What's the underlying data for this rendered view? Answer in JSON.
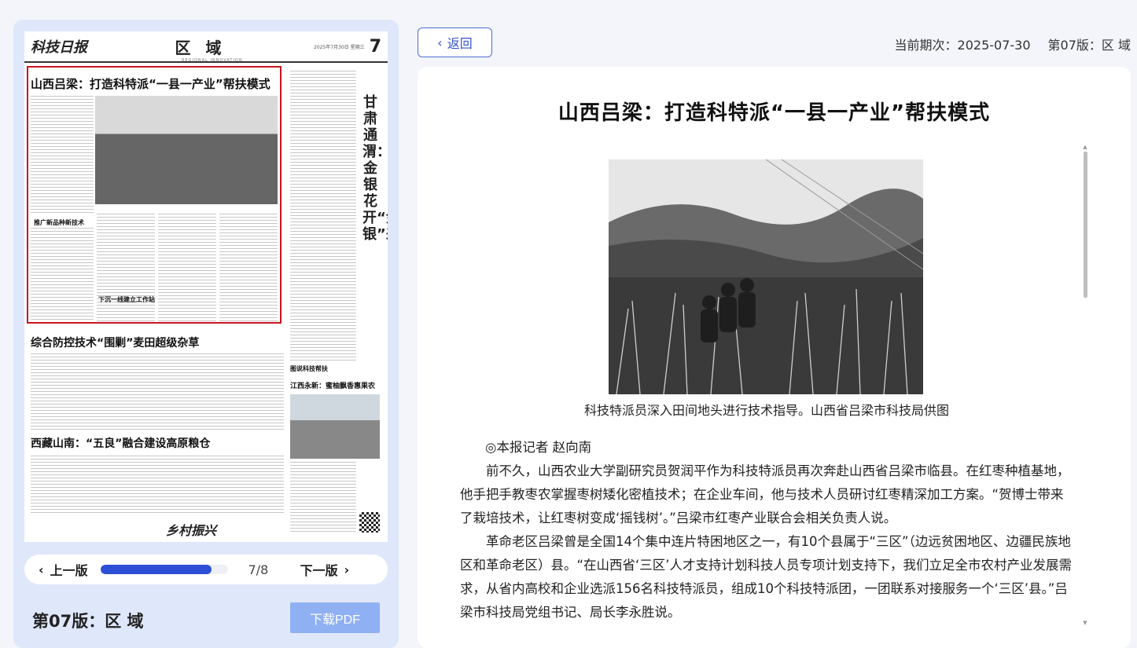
{
  "newspaper": {
    "masthead": "科技日报",
    "section": "区 域",
    "section_en": "REGIONAL INNOVATION",
    "date_line": "2025年7月30日 星期三",
    "page_no": "7",
    "headline_main": "山西吕梁：打造科特派“一县一产业”帮扶模式",
    "headline_2": "综合防控技术“围剿”麦田超级杂草",
    "headline_3": "西藏山南：“五良”融合建设高原粮仓",
    "subhead_1": "推广新品种新技术",
    "subhead_2": "下沉一线建立工作站",
    "vertical_headline": "甘肃通渭：金银花开“金银”来",
    "photo_column": "图说科技帮扶",
    "photo_headline": "江西永新：蜜柚飘香惠果农",
    "banner": "乡村振兴"
  },
  "pager": {
    "prev_label": "上一版",
    "next_label": "下一版",
    "page_count": "7/8",
    "progress": 0.875
  },
  "edition_title": "第07版：区 域",
  "pdf_button": "下载PDF",
  "back_button": "返回",
  "issue": {
    "date_label": "当前期次：2025-07-30",
    "edition_label": "第07版：区 域"
  },
  "article": {
    "title": "山西吕梁：打造科特派“一县一产业”帮扶模式",
    "caption": "科技特派员深入田间地头进行技术指导。山西省吕梁市科技局供图",
    "byline": "◎本报记者 赵向南",
    "paragraphs": [
      "前不久，山西农业大学副研究员贺润平作为科技特派员再次奔赴山西省吕梁市临县。在红枣种植基地，他手把手教枣农掌握枣树矮化密植技术；在企业车间，他与技术人员研讨红枣精深加工方案。“贺博士带来了栽培技术，让红枣树变成‘摇钱树’。”吕梁市红枣产业联合会相关负责人说。",
      "革命老区吕梁曾是全国14个集中连片特困地区之一，有10个县属于“三区”（边远贫困地区、边疆民族地区和革命老区）县。“在山西省‘三区’人才支持计划科技人员专项计划支持下，我们立足全市农村产业发展需求，从省内高校和企业选派156名科技特派员，组成10个科技特派团，一团联系对接服务一个‘三区’县。”吕梁市科技局党组书记、局长李永胜说。"
    ]
  }
}
